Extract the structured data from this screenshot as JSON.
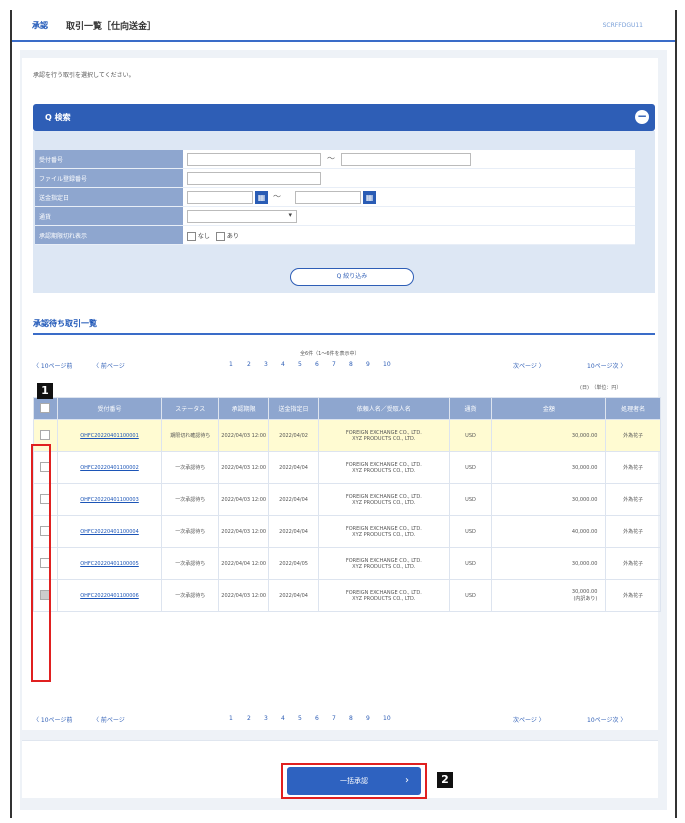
{
  "header": {
    "screen_tag": "承認",
    "title": "取引一覧［仕向送金］",
    "screen_code": "SCRFFDGU11"
  },
  "message": "承認を行う取引を選択してください。",
  "search": {
    "title": "Q 検索",
    "toggle": "−",
    "fields": [
      {
        "label": "受付番号"
      },
      {
        "label": "ファイル登録番号"
      },
      {
        "label": "送金指定日"
      },
      {
        "label": "通貨"
      },
      {
        "label": "承認期限切れ表示"
      }
    ],
    "option_none": "なし",
    "option_yes": "あり",
    "narrow_button": "Q 絞り込み"
  },
  "list": {
    "title": "承認待ち取引一覧",
    "count_text": "全6件（1〜6件を表示中）",
    "prev10": "〈 10ページ前",
    "prev": "〈 前ページ",
    "next": "次ページ 〉",
    "next10": "10ページ次 〉",
    "pages": [
      "1",
      "2",
      "3",
      "4",
      "5",
      "6",
      "7",
      "8",
      "9",
      "10"
    ],
    "unit": "(日)　（単位：円）",
    "columns": [
      "受付番号",
      "ステータス",
      "承認期限",
      "送金指定日",
      "依頼人名／受取人名",
      "通貨",
      "金額",
      "処理者名"
    ],
    "rows": [
      {
        "id": "OHFC20220401100001",
        "status": "期限切れ確認待ち",
        "deadline": "2022/04/03 12:00",
        "date": "2022/04/02",
        "sender": "FOREIGN EXCHANGE CO., LTD.",
        "receiver": "XYZ PRODUCTS CO., LTD.",
        "currency": "USD",
        "amount": "30,000.00",
        "user": "外為花子"
      },
      {
        "id": "OHFC20220401100002",
        "status": "一次承認待ち",
        "deadline": "2022/04/03 12:00",
        "date": "2022/04/04",
        "sender": "FOREIGN EXCHANGE CO., LTD.",
        "receiver": "XYZ PRODUCTS CO., LTD.",
        "currency": "USD",
        "amount": "30,000.00",
        "user": "外為花子"
      },
      {
        "id": "OHFC20220401100003",
        "status": "一次承認待ち",
        "deadline": "2022/04/03 12:00",
        "date": "2022/04/04",
        "sender": "FOREIGN EXCHANGE CO., LTD.",
        "receiver": "XYZ PRODUCTS CO., LTD.",
        "currency": "USD",
        "amount": "30,000.00",
        "user": "外為花子"
      },
      {
        "id": "OHFC20220401100004",
        "status": "一次承認待ち",
        "deadline": "2022/04/03 12:00",
        "date": "2022/04/04",
        "sender": "FOREIGN EXCHANGE CO., LTD.",
        "receiver": "XYZ PRODUCTS CO., LTD.",
        "currency": "USD",
        "amount": "40,000.00",
        "user": "外為花子"
      },
      {
        "id": "OHFC20220401100005",
        "status": "一次承認待ち",
        "deadline": "2022/04/04 12:00",
        "date": "2022/04/05",
        "sender": "FOREIGN EXCHANGE CO., LTD.",
        "receiver": "XYZ PRODUCTS CO., LTD.",
        "currency": "USD",
        "amount": "30,000.00",
        "user": "外為花子"
      },
      {
        "id": "OHFC20220401100006",
        "status": "一次承認待ち",
        "deadline": "2022/04/03 12:00",
        "date": "2022/04/04",
        "sender": "FOREIGN EXCHANGE CO., LTD.",
        "receiver": "XYZ PRODUCTS CO., LTD.",
        "currency": "USD",
        "amount": "30,000.00",
        "amount_note": "(内訳あり)",
        "user": "外為花子"
      }
    ]
  },
  "apply_button": "一括承認",
  "badges": [
    "1",
    "2"
  ],
  "colors": {
    "accent": "#2e5eb6",
    "highlight_row": "#fffbd2",
    "annotation": "#e02020"
  }
}
